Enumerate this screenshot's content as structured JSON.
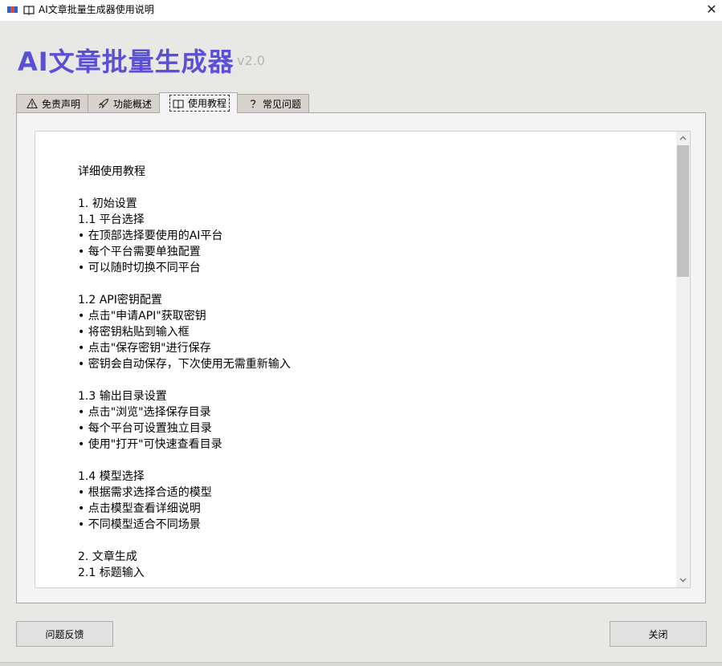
{
  "window": {
    "title": "AI文章批量生成器使用说明",
    "close_glyph": "✕"
  },
  "header": {
    "app_name": "AI文章批量生成器",
    "version": "v2.0"
  },
  "tabs": [
    {
      "label": "免责声明",
      "icon": "warning-icon"
    },
    {
      "label": "功能概述",
      "icon": "rocket-icon"
    },
    {
      "label": "使用教程",
      "icon": "book-icon",
      "active": true
    },
    {
      "label": "常见问题",
      "icon": "question-icon"
    }
  ],
  "content": {
    "text": "详细使用教程\n\n1. 初始设置\n1.1 平台选择\n• 在顶部选择要使用的AI平台\n• 每个平台需要单独配置\n• 可以随时切换不同平台\n\n1.2 API密钥配置\n• 点击\"申请API\"获取密钥\n• 将密钥粘贴到输入框\n• 点击\"保存密钥\"进行保存\n• 密钥会自动保存，下次使用无需重新输入\n\n1.3 输出目录设置\n• 点击\"浏览\"选择保存目录\n• 每个平台可设置独立目录\n• 使用\"打开\"可快速查看目录\n\n1.4 模型选择\n• 根据需求选择合适的模型\n• 点击模型查看详细说明\n• 不同模型适合不同场景\n\n2. 文章生成\n2.1 标题输入"
  },
  "scrollbar": {
    "up_glyph": "︿",
    "down_glyph": "﹀"
  },
  "buttons": {
    "feedback": "问题反馈",
    "close": "关闭"
  },
  "colors": {
    "title_accent": "#5a4fd6",
    "version_gray": "#b4b4b4"
  }
}
